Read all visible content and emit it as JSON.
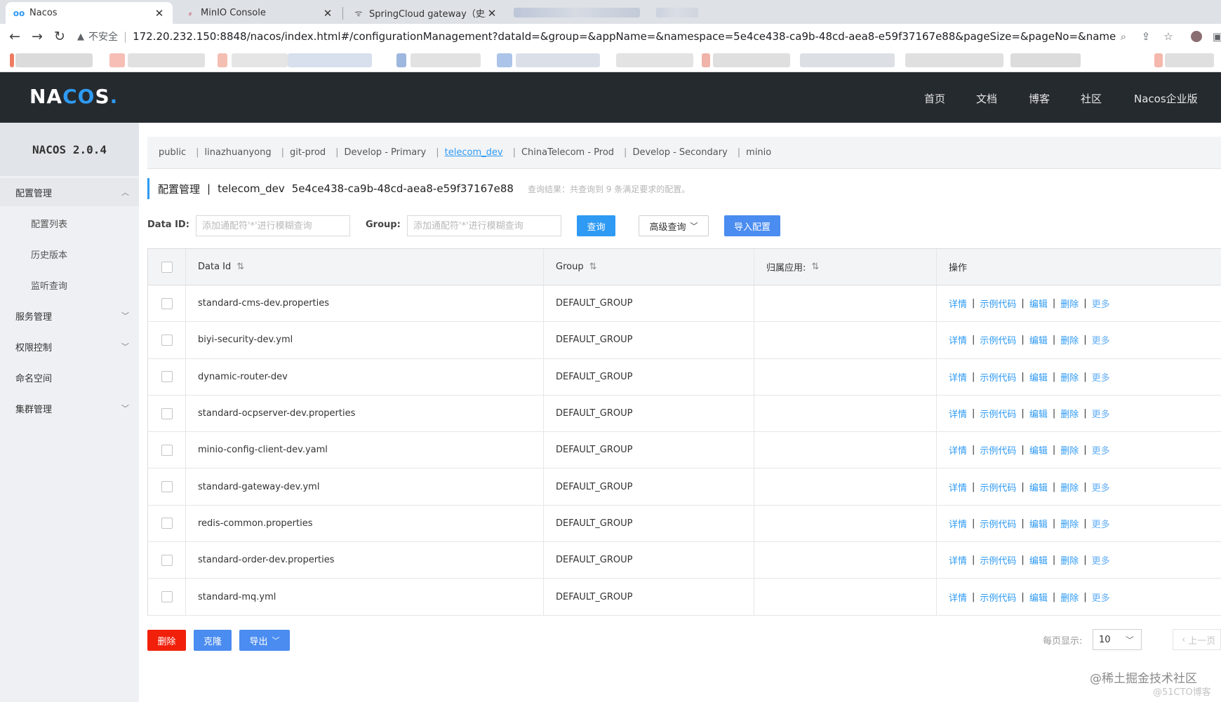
{
  "browser": {
    "tabs": [
      {
        "title": "Nacos",
        "icon": "nacos-favicon",
        "active": true
      },
      {
        "title": "MinIO Console",
        "icon": "minio-favicon",
        "active": false
      },
      {
        "title": "SpringCloud gateway（史上最",
        "icon": "gateway-favicon",
        "active": false
      }
    ],
    "close_glyph": "✕",
    "insecure_label": "不安全",
    "url": "172.20.232.150:8848/nacos/index.html#/configurationManagement?dataId=&group=&appName=&namespace=5e4ce438-ca9b-48cd-aea8-e59f37167e88&pageSize=&pageNo=&namespaceShowName..."
  },
  "header": {
    "logo": {
      "pre": "NA",
      "mid": "CO",
      "post": "S",
      "dot": "."
    },
    "nav": [
      "首页",
      "文档",
      "博客",
      "社区",
      "Nacos企业版"
    ]
  },
  "sidebar": {
    "title": "NACOS 2.0.4",
    "items": [
      {
        "label": "配置管理",
        "level": 0,
        "chevron": "up"
      },
      {
        "label": "配置列表",
        "level": 1
      },
      {
        "label": "历史版本",
        "level": 1
      },
      {
        "label": "监听查询",
        "level": 1
      },
      {
        "label": "服务管理",
        "level": 0,
        "chevron": "down"
      },
      {
        "label": "权限控制",
        "level": 0,
        "chevron": "down"
      },
      {
        "label": "命名空间",
        "level": 0
      },
      {
        "label": "集群管理",
        "level": 0,
        "chevron": "down"
      }
    ]
  },
  "namespaces": {
    "items": [
      "public",
      "linazhuanyong",
      "git-prod",
      "Develop - Primary",
      "telecom_dev",
      "ChinaTelecom - Prod",
      "Develop - Secondary",
      "minio"
    ],
    "active": "telecom_dev",
    "separator": "|"
  },
  "breadcrumb": {
    "section": "配置管理",
    "separator": "|",
    "namespace": "telecom_dev",
    "namespace_id": "5e4ce438-ca9b-48cd-aea8-e59f37167e88",
    "summary": "查询结果：共查询到 9 条满足要求的配置。"
  },
  "filters": {
    "data_id_label": "Data ID:",
    "data_id_placeholder": "添加通配符'*'进行模糊查询",
    "group_label": "Group:",
    "group_placeholder": "添加通配符'*'进行模糊查询",
    "query_button": "查询",
    "advanced_button": "高级查询",
    "import_button": "导入配置"
  },
  "table": {
    "columns": {
      "data_id": "Data Id",
      "group": "Group",
      "app": "归属应用:",
      "ops": "操作"
    },
    "sort_glyph": "⇅",
    "rows": [
      {
        "data_id": "standard-cms-dev.properties",
        "group": "DEFAULT_GROUP",
        "app": ""
      },
      {
        "data_id": "biyi-security-dev.yml",
        "group": "DEFAULT_GROUP",
        "app": ""
      },
      {
        "data_id": "dynamic-router-dev",
        "group": "DEFAULT_GROUP",
        "app": ""
      },
      {
        "data_id": "standard-ocpserver-dev.properties",
        "group": "DEFAULT_GROUP",
        "app": ""
      },
      {
        "data_id": "minio-config-client-dev.yaml",
        "group": "DEFAULT_GROUP",
        "app": ""
      },
      {
        "data_id": "standard-gateway-dev.yml",
        "group": "DEFAULT_GROUP",
        "app": ""
      },
      {
        "data_id": "redis-common.properties",
        "group": "DEFAULT_GROUP",
        "app": ""
      },
      {
        "data_id": "standard-order-dev.properties",
        "group": "DEFAULT_GROUP",
        "app": ""
      },
      {
        "data_id": "standard-mq.yml",
        "group": "DEFAULT_GROUP",
        "app": ""
      }
    ],
    "row_ops": [
      "详情",
      "示例代码",
      "编辑",
      "删除",
      "更多"
    ]
  },
  "footer": {
    "delete_button": "删除",
    "clone_button": "克隆",
    "export_button": "导出",
    "page_size_label": "每页显示:",
    "page_size_value": "10",
    "prev_button": "上一页"
  },
  "watermark": {
    "main": "@稀土掘金技术社区",
    "sub": "@51CTO博客"
  },
  "colors": {
    "accent": "#2e9af3",
    "danger": "#f1200b",
    "header_bg": "#252a2f"
  }
}
